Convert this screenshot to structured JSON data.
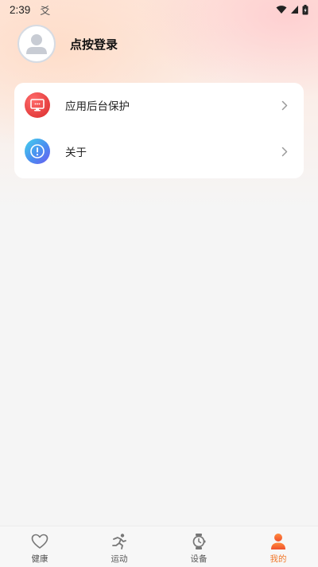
{
  "status_bar": {
    "time": "2:39",
    "notification_glyph": "爻",
    "icons": [
      "wifi-icon",
      "signal-icon",
      "battery-icon"
    ]
  },
  "profile": {
    "avatar_icon": "user-avatar-icon",
    "login_text": "点按登录"
  },
  "menu": {
    "items": [
      {
        "label": "应用后台保护",
        "icon": "monitor-icon",
        "color": "#e53e3e"
      },
      {
        "label": "关于",
        "icon": "info-icon",
        "color": "#4a8df0"
      }
    ]
  },
  "tabbar": {
    "tabs": [
      {
        "label": "健康",
        "icon": "heart-icon",
        "active": false
      },
      {
        "label": "运动",
        "icon": "runner-icon",
        "active": false
      },
      {
        "label": "设备",
        "icon": "watch-icon",
        "active": false
      },
      {
        "label": "我的",
        "icon": "person-icon",
        "active": true
      }
    ],
    "active_color": "#f07a2e"
  }
}
